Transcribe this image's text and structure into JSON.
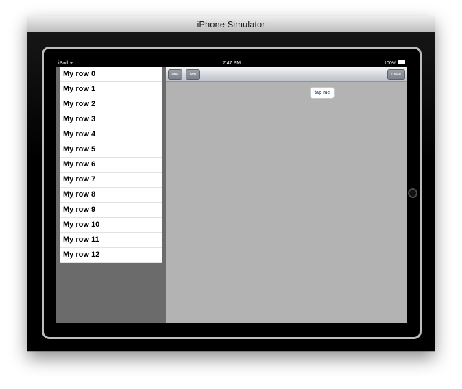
{
  "window": {
    "title": "iPhone Simulator"
  },
  "statusbar": {
    "device": "iPad",
    "time": "7:47 PM",
    "battery": "100%"
  },
  "master": {
    "rows": [
      "My row 0",
      "My row 1",
      "My row 2",
      "My row 3",
      "My row 4",
      "My row 5",
      "My row 6",
      "My row 7",
      "My row 8",
      "My row 9",
      "My row 10",
      "My row 11",
      "My row 12"
    ]
  },
  "toolbar": {
    "one": "one",
    "two": "two",
    "three": "three"
  },
  "detail": {
    "tap_label": "tap me"
  }
}
